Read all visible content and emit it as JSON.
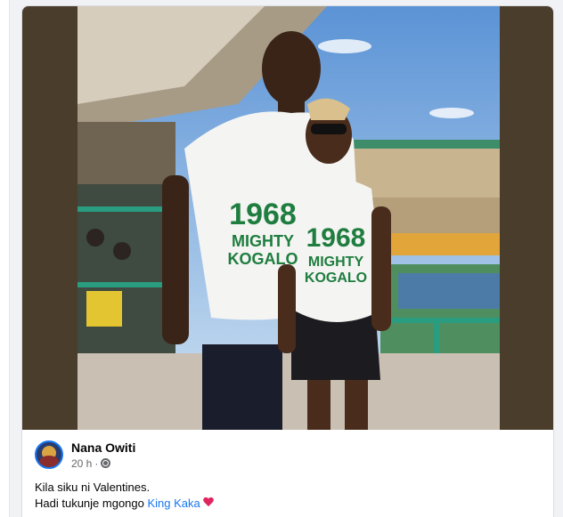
{
  "post": {
    "author_name": "Nana Owiti",
    "timestamp": "20 h",
    "separator": "·",
    "audience_icon": "globe-icon",
    "text_line1": "Kila siku ni Valentines.",
    "text_line2_prefix": "Hadi tukunje mgongo ",
    "tagged_name": "King Kaka",
    "emoji": "heart-icon"
  },
  "photo": {
    "shirt_text_top": "1968",
    "shirt_text_bottom_1": "MIGHTY",
    "shirt_text_bottom_2": "KOGALO"
  },
  "colors": {
    "link": "#1877f2",
    "photo_frame": "#4b3d2c",
    "heart": "#e0245e"
  }
}
